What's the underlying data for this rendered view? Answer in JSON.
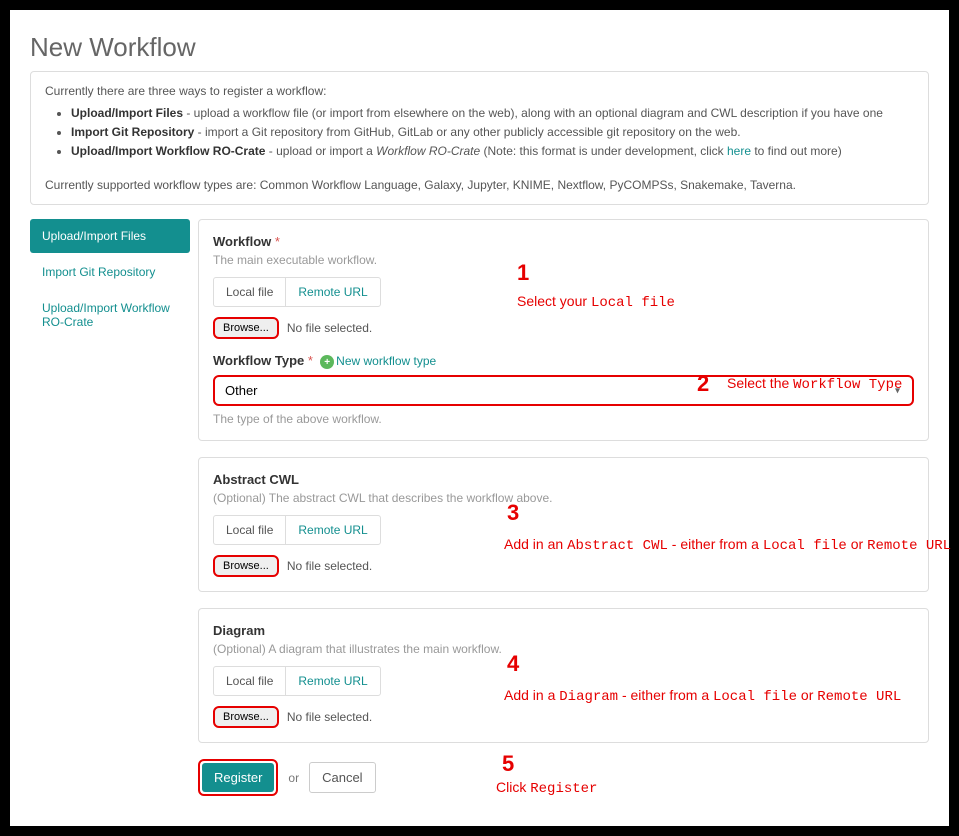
{
  "title": "New Workflow",
  "info": {
    "intro": "Currently there are three ways to register a workflow:",
    "items": [
      {
        "strong": "Upload/Import Files",
        "rest": " - upload a workflow file (or import from elsewhere on the web), along with an optional diagram and CWL description if you have one"
      },
      {
        "strong": "Import Git Repository",
        "rest": " - import a Git repository from GitHub, GitLab or any other publicly accessible git repository on the web."
      },
      {
        "strong": "Upload/Import Workflow RO-Crate",
        "rest_pre": " - upload or import a ",
        "em": "Workflow RO-Crate",
        "rest_post": " (Note: this format is under development, click ",
        "link": "here",
        "rest_end": " to find out more)"
      }
    ],
    "supported": "Currently supported workflow types are: Common Workflow Language, Galaxy, Jupyter, KNIME, Nextflow, PyCOMPSs, Snakemake, Taverna."
  },
  "sidebar": {
    "items": [
      {
        "label": "Upload/Import Files",
        "active": true
      },
      {
        "label": "Import Git Repository",
        "active": false
      },
      {
        "label": "Upload/Import Workflow RO-Crate",
        "active": false
      }
    ]
  },
  "main": {
    "workflow": {
      "label": "Workflow",
      "desc": "The main executable workflow.",
      "tab1": "Local file",
      "tab2": "Remote URL",
      "browse": "Browse...",
      "no_file": "No file selected.",
      "type_label": "Workflow Type",
      "new_type": "New workflow type",
      "select_value": "Other",
      "type_desc": "The type of the above workflow."
    },
    "cwl": {
      "label": "Abstract CWL",
      "desc": "(Optional) The abstract CWL that describes the workflow above.",
      "tab1": "Local file",
      "tab2": "Remote URL",
      "browse": "Browse...",
      "no_file": "No file selected."
    },
    "diagram": {
      "label": "Diagram",
      "desc": "(Optional) A diagram that illustrates the main workflow.",
      "tab1": "Local file",
      "tab2": "Remote URL",
      "browse": "Browse...",
      "no_file": "No file selected."
    },
    "actions": {
      "register": "Register",
      "or": "or",
      "cancel": "Cancel"
    }
  },
  "annotations": {
    "n1": "1",
    "t1a": "Select your ",
    "t1b": "Local file",
    "n2": "2",
    "t2a": "Select the ",
    "t2b": "Workflow Type",
    "n3": "3",
    "t3a": "Add in an ",
    "t3b": "Abstract CWL",
    "t3c": " - either from a ",
    "t3d": "Local file",
    "t3e": " or ",
    "t3f": "Remote URL",
    "n4": "4",
    "t4a": "Add in a ",
    "t4b": "Diagram",
    "t4c": " - either from a ",
    "t4d": "Local file",
    "t4e": " or ",
    "t4f": "Remote URL",
    "n5": "5",
    "t5a": "Click ",
    "t5b": "Register"
  }
}
